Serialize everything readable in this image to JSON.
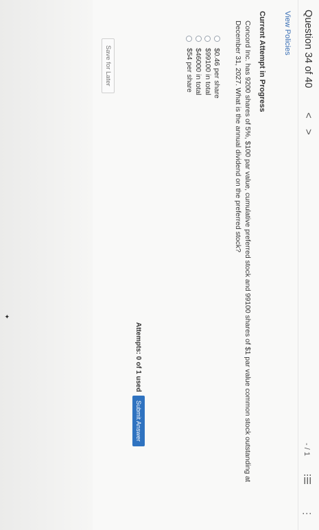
{
  "header": {
    "question_label": "Question 34 of 40",
    "prev_symbol": "<",
    "next_symbol": ">",
    "score": "- / 1",
    "more_symbol": "⋮"
  },
  "links": {
    "view_policies": "View Policies"
  },
  "attempt": {
    "heading": "Current Attempt in Progress"
  },
  "question": {
    "text": "Concord Inc. has 9200 shares of 5%, $100 par value, cumulative preferred stock and 99100 shares of $1 par value common stock outstanding at December 31, 2027. What is the annual dividend on the preferred stock?",
    "options": [
      {
        "label": "$0.46 per share"
      },
      {
        "label": "$99100 in total"
      },
      {
        "label": "$46000 in total"
      },
      {
        "label": "$54 per share"
      }
    ]
  },
  "footer": {
    "save_label": "Save for Later",
    "attempts_label": "Attempts: 0 of 1 used",
    "submit_label": "Submit Answer"
  },
  "colors": {
    "link": "#3a6fb5",
    "accent": "#2f73c0"
  }
}
